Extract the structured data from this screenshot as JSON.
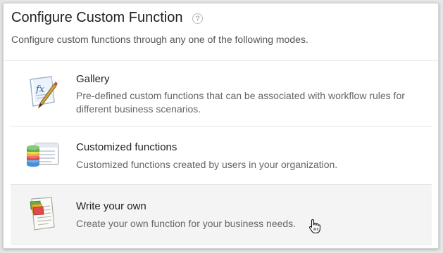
{
  "dialog": {
    "title": "Configure Custom Function",
    "help_glyph": "?",
    "subtitle": "Configure custom functions through any one of the following modes."
  },
  "options": [
    {
      "title": "Gallery",
      "description": "Pre-defined custom functions that can be associated with workflow rules for different business scenarios.",
      "icon": "gallery-fx-icon"
    },
    {
      "title": "Customized functions",
      "description": "Customized functions created by users in your organization.",
      "icon": "customized-functions-icon"
    },
    {
      "title": "Write your own",
      "description": "Create your own function for your business needs.",
      "icon": "write-your-own-icon"
    }
  ],
  "colors": {
    "hover_background": "#f4f4f4",
    "title_text": "#222222",
    "description_text": "#666666"
  }
}
